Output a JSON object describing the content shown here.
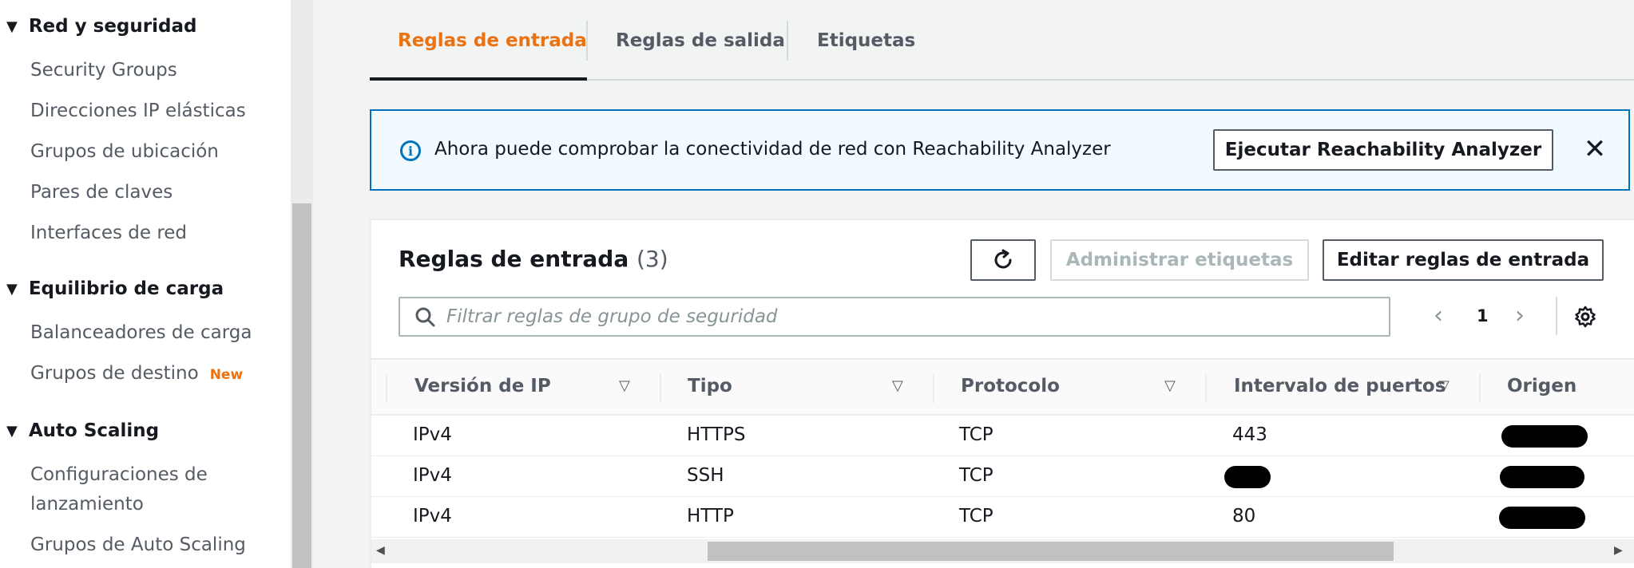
{
  "sidebar": {
    "sections": [
      {
        "title": "Red y seguridad",
        "items": [
          "Security Groups",
          "Direcciones IP elásticas",
          "Grupos de ubicación",
          "Pares de claves",
          "Interfaces de red"
        ]
      },
      {
        "title": "Equilibrio de carga",
        "items": [
          "Balanceadores de carga",
          "Grupos de destino"
        ]
      },
      {
        "title": "Auto Scaling",
        "items": [
          "Configuraciones de",
          "lanzamiento",
          "Grupos de Auto Scaling"
        ]
      }
    ],
    "new_badge": "New"
  },
  "tabs": [
    "Reglas de entrada",
    "Reglas de salida",
    "Etiquetas"
  ],
  "flash": {
    "text": "Ahora puede comprobar la conectividad de red con Reachability Analyzer",
    "button": "Ejecutar Reachability Analyzer"
  },
  "rules": {
    "title": "Reglas de entrada",
    "count": "(3)",
    "manage_tags": "Administrar etiquetas",
    "edit_rules": "Editar reglas de entrada",
    "search_placeholder": "Filtrar reglas de grupo de seguridad",
    "page": "1",
    "columns": [
      "Versión de IP",
      "Tipo",
      "Protocolo",
      "Intervalo de puertos",
      "Origen"
    ],
    "rows": [
      [
        "IPv4",
        "HTTPS",
        "TCP",
        "443"
      ],
      [
        "IPv4",
        "SSH",
        "TCP",
        ""
      ],
      [
        "IPv4",
        "HTTP",
        "TCP",
        "80"
      ]
    ]
  },
  "colors": {
    "accent": "#ec7211",
    "info_border": "#0073bb",
    "info_bg": "#f1faff"
  }
}
